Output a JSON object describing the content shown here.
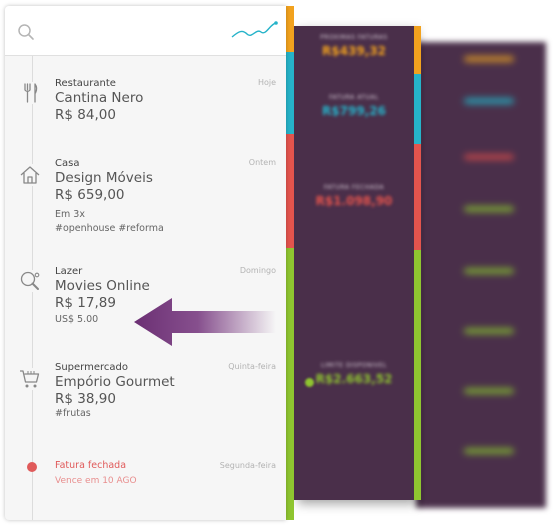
{
  "colors": {
    "orange": "#f2a21e",
    "teal": "#26b3c9",
    "red": "#e4544d",
    "green": "#8fc530",
    "purple": "#4a2f4a",
    "arrow": "#6b2f73"
  },
  "search": {
    "icon": "search-icon"
  },
  "chart": {
    "icon": "trend-line-icon"
  },
  "transactions": [
    {
      "category": "Restaurante",
      "name": "Cantina Nero",
      "amount": "R$ 84,00",
      "date": "Hoje",
      "icon": "cutlery-icon",
      "details": []
    },
    {
      "category": "Casa",
      "name": "Design Móveis",
      "amount": "R$ 659,00",
      "date": "Ontem",
      "icon": "house-icon",
      "details": [
        "Em 3x",
        "#openhouse  #reforma"
      ]
    },
    {
      "category": "Lazer",
      "name": "Movies Online",
      "amount": "R$ 17,89",
      "date": "Domingo",
      "icon": "ping-pong-icon",
      "details": [
        "US$ 5.00"
      ]
    },
    {
      "category": "Supermercado",
      "name": "Empório Gourmet",
      "amount": "R$ 38,90",
      "date": "Quinta-feira",
      "icon": "shopping-cart-icon",
      "details": [
        "#frutas"
      ]
    }
  ],
  "fatura": {
    "title": "Fatura fechada",
    "subtitle": "Vence em 10 AGO",
    "date": "Segunda-feira"
  },
  "summary": [
    {
      "label": "PRÓXIMAS FATURAS",
      "value": "R$439,32",
      "color": "#f2a21e"
    },
    {
      "label": "FATURA ATUAL",
      "value": "R$799,26",
      "color": "#26b3c9"
    },
    {
      "label": "FATURA FECHADA",
      "value": "R$1.098,90",
      "color": "#e4544d"
    },
    {
      "label": "LIMITE DISPONÍVEL",
      "value": "R$2.663,52",
      "color": "#8fc530"
    }
  ]
}
